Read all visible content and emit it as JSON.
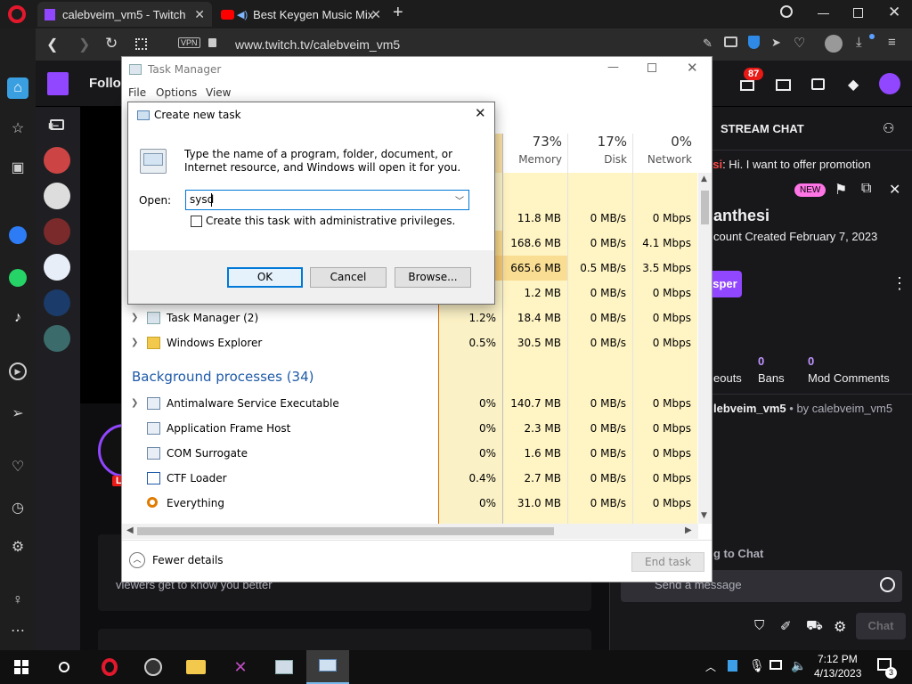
{
  "browser": {
    "tabs": [
      {
        "title": "calebveim_vm5 - Twitch"
      },
      {
        "title": "Best Keygen Music Mix"
      }
    ],
    "new_tab": "+",
    "vpn_label": "VPN",
    "url": "www.twitch.tv/calebveim_vm5"
  },
  "twitch": {
    "follow_label": "Follo",
    "notification_count": "87",
    "stream_chat_label": "STREAM CHAT",
    "chat_message_user": "esi",
    "chat_message_text": ": Hi. I want to offer promotion",
    "new_badge": "NEW",
    "user_name": "anthesi",
    "account_created": "count Created February 7, 2023",
    "whisper_label": "sper",
    "stats": [
      {
        "count": "",
        "label": "eouts"
      },
      {
        "count": "0",
        "label": "Bans"
      },
      {
        "count": "0",
        "label": "Mod Comments"
      }
    ],
    "mod_line_user": "lebveim_vm5",
    "mod_line_rest": " • by calebveim_vm5",
    "chat_welcome": "g to Chat",
    "send_placeholder": "Send a message",
    "chat_button": "Chat",
    "main_caption": "viewers get to know you better",
    "live_badge": "L"
  },
  "taskmgr": {
    "title": "Task Manager",
    "menu": [
      "File",
      "Options",
      "View"
    ],
    "columns": [
      {
        "pct": "73%",
        "label": "Memory"
      },
      {
        "pct": "17%",
        "label": "Disk"
      },
      {
        "pct": "0%",
        "label": "Network"
      }
    ],
    "rows": [
      {
        "name": "",
        "cpu": "",
        "mem": "11.8 MB",
        "disk": "0 MB/s",
        "net": "0 Mbps"
      },
      {
        "name": "",
        "cpu": "",
        "mem": "168.6 MB",
        "disk": "0 MB/s",
        "net": "4.1 Mbps"
      },
      {
        "name": "",
        "cpu": "",
        "mem": "665.6 MB",
        "disk": "0.5 MB/s",
        "net": "3.5 Mbps"
      },
      {
        "name": "",
        "cpu": "",
        "mem": "1.2 MB",
        "disk": "0 MB/s",
        "net": "0 Mbps"
      },
      {
        "name": "Task Manager (2)",
        "cpu": "1.2%",
        "mem": "18.4 MB",
        "disk": "0 MB/s",
        "net": "0 Mbps"
      },
      {
        "name": "Windows Explorer",
        "cpu": "0.5%",
        "mem": "30.5 MB",
        "disk": "0 MB/s",
        "net": "0 Mbps"
      }
    ],
    "bg_header": "Background processes (34)",
    "bg_rows": [
      {
        "name": "Antimalware Service Executable",
        "cpu": "0%",
        "mem": "140.7 MB",
        "disk": "0 MB/s",
        "net": "0 Mbps"
      },
      {
        "name": "Application Frame Host",
        "cpu": "0%",
        "mem": "2.3 MB",
        "disk": "0 MB/s",
        "net": "0 Mbps"
      },
      {
        "name": "COM Surrogate",
        "cpu": "0%",
        "mem": "1.6 MB",
        "disk": "0 MB/s",
        "net": "0 Mbps"
      },
      {
        "name": "CTF Loader",
        "cpu": "0.4%",
        "mem": "2.7 MB",
        "disk": "0 MB/s",
        "net": "0 Mbps"
      },
      {
        "name": "Everything",
        "cpu": "0%",
        "mem": "31.0 MB",
        "disk": "0 MB/s",
        "net": "0 Mbps"
      }
    ],
    "fewer_details": "Fewer details",
    "end_task": "End task"
  },
  "dialog": {
    "title": "Create new task",
    "description": "Type the name of a program, folder, document, or Internet resource, and Windows will open it for you.",
    "open_label": "Open:",
    "open_value": "sysd",
    "admin_label": "Create this task with administrative privileges.",
    "ok": "OK",
    "cancel": "Cancel",
    "browse": "Browse..."
  },
  "taskbar": {
    "time": "7:12 PM",
    "date": "4/13/2023",
    "notif_count": "3"
  }
}
